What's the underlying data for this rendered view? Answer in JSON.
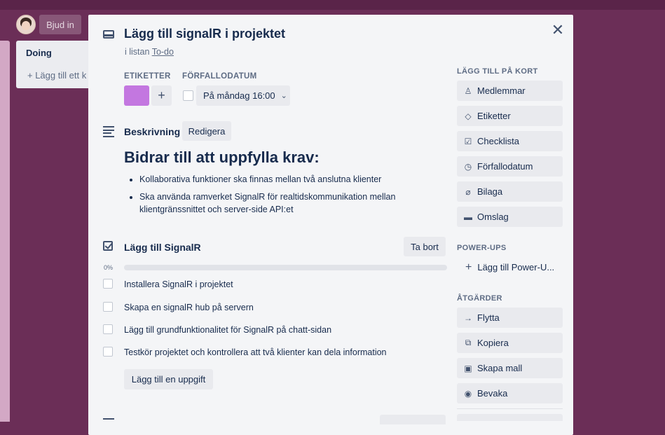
{
  "board": {
    "invite_label": "Bjud in",
    "doing_list": {
      "title": "Doing",
      "add_card": "+ Lägg till ett k"
    }
  },
  "card": {
    "title": "Lägg till signalR i projektet",
    "in_list_prefix": "i listan",
    "list_name": "To-do",
    "close_icon": "close-icon",
    "labels_heading": "ETIKETTER",
    "label_color": "#c377e0",
    "add_label": "+",
    "due_heading": "FÖRFALLODATUM",
    "due_value": "På måndag 16:00",
    "description": {
      "title": "Beskrivning",
      "edit_label": "Redigera",
      "heading": "Bidrar till att uppfylla krav:",
      "bullets": [
        "Kollaborativa funktioner ska finnas mellan två anslutna klienter",
        "Ska använda ramverket SignalR för realtidskommunikation mellan klientgränssnittet och server-side API:et"
      ]
    },
    "checklist": {
      "title": "Lägg till SignalR",
      "delete_label": "Ta bort",
      "percent": "0%",
      "progress_fraction": 0,
      "items": [
        "Installera SignalR i projektet",
        "Skapa en signalR hub på servern",
        "Lägg till grundfunktionalitet för SignalR på chatt-sidan",
        "Testkör projektet och kontrollera att två klienter kan dela information"
      ],
      "add_item_label": "Lägg till en uppgift"
    }
  },
  "sidebar": {
    "add_to_card_heading": "LÄGG TILL PÅ KORT",
    "add_to_card": [
      {
        "label": "Medlemmar",
        "icon": "person-icon"
      },
      {
        "label": "Etiketter",
        "icon": "tag-icon"
      },
      {
        "label": "Checklista",
        "icon": "checklist-icon"
      },
      {
        "label": "Förfallodatum",
        "icon": "clock-icon"
      },
      {
        "label": "Bilaga",
        "icon": "paperclip-icon"
      },
      {
        "label": "Omslag",
        "icon": "cover-icon"
      }
    ],
    "powerups_heading": "POWER-UPS",
    "add_powerup": "Lägg till Power-U...",
    "actions_heading": "ÅTGÄRDER",
    "actions": [
      {
        "label": "Flytta",
        "icon": "arrow-right-icon"
      },
      {
        "label": "Kopiera",
        "icon": "copy-icon"
      },
      {
        "label": "Skapa mall",
        "icon": "template-icon"
      },
      {
        "label": "Bevaka",
        "icon": "eye-icon"
      }
    ]
  }
}
